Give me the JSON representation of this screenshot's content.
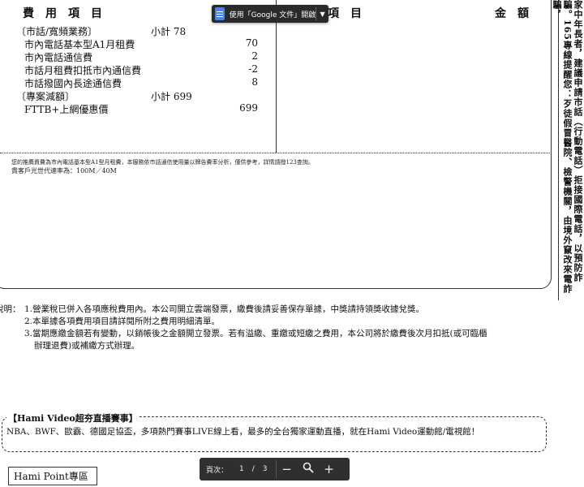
{
  "bill": {
    "header_left": "費用項目",
    "header_mid": "用項目",
    "header_right": "金額",
    "sections": [
      {
        "category": "〔市話/寬頻業務〕",
        "subtotal": "小計 78",
        "items": [
          {
            "name": "市內電話基本型A1月租費",
            "amount": "70"
          },
          {
            "name": "市內電話通信費",
            "amount": "2"
          },
          {
            "name": "市話月租費扣抵市內通信費",
            "amount": "-2"
          },
          {
            "name": "市話撥國內長途通信費",
            "amount": "8"
          }
        ]
      },
      {
        "category": "〔專案減額〕",
        "subtotal": "小計 699",
        "items": [
          {
            "name": "FTTB+上網優惠價",
            "amount": "699"
          }
        ]
      }
    ],
    "note_line1": "您的推薦資費為市內電話基本型A1型月租費，本服務依市話通信使用量以牌告費率分析，僅供參考，詳情請撥123查詢。",
    "note_line2": "貴客戶光世代速率為：100M／40M"
  },
  "side_notice": "家中年長者，建議申請市話（行動電話）拒接國際電話，以預防詐騙。165專線提醒您：歹徒假冒醫院、檢警機關，由境外竄改來電詐騙，",
  "gdoc_button": {
    "label": "使用「Google 文件」開啟",
    "icon": "google-docs-icon",
    "color": "#4285f4"
  },
  "notes": {
    "prefix": "說明：",
    "line1": "1.營業稅已併入各項應稅費用內。本公司開立雲端發票，繳費後請妥善保存單據，中獎請持領獎收據兌獎。",
    "line2": "2.本單據各項費用項目請詳閱所附之費用明細清單。",
    "line3": "3.當期應繳金額若有變動，以銷帳後之金額開立發票。若有溢繳、重繳或短繳之費用，本公司將於繳費後次月扣抵(或可臨櫃",
    "line4": "辦理退費)或補繳方式辦理。"
  },
  "hami": {
    "title": "【Hami Video超夯直播賽事】",
    "text": "NBA、BWF、歐霸、德國足協盃，多項熱門賽事LIVE線上看，最多的全台獨家運動直播，就在Hami Video運動館/電視館！"
  },
  "point": {
    "label": "Hami Point專區"
  },
  "pager": {
    "label": "頁次：",
    "current": "1",
    "separator": "/",
    "total": "3"
  }
}
